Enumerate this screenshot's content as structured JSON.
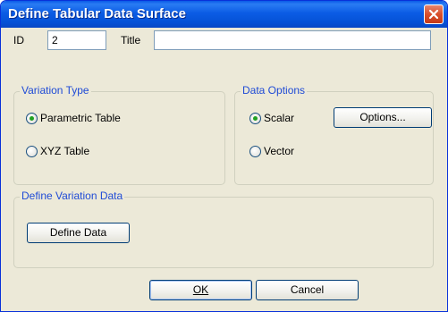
{
  "window": {
    "title": "Define Tabular Data Surface"
  },
  "id_field": {
    "label": "ID",
    "value": "2"
  },
  "title_field": {
    "label": "Title",
    "value": ""
  },
  "variation_type": {
    "legend": "Variation Type",
    "options": [
      {
        "label": "Parametric Table",
        "selected": true
      },
      {
        "label": "XYZ Table",
        "selected": false
      }
    ]
  },
  "data_options": {
    "legend": "Data Options",
    "options": [
      {
        "label": "Scalar",
        "selected": true
      },
      {
        "label": "Vector",
        "selected": false
      }
    ],
    "options_button": "Options..."
  },
  "define_variation": {
    "legend": "Define Variation Data",
    "button": "Define Data"
  },
  "buttons": {
    "ok": "OK",
    "cancel": "Cancel"
  },
  "icons": {
    "close": "close-icon"
  },
  "colors": {
    "titlebar": "#0b5ce5",
    "legend_text": "#1f4bd6",
    "close": "#d94f2b"
  }
}
